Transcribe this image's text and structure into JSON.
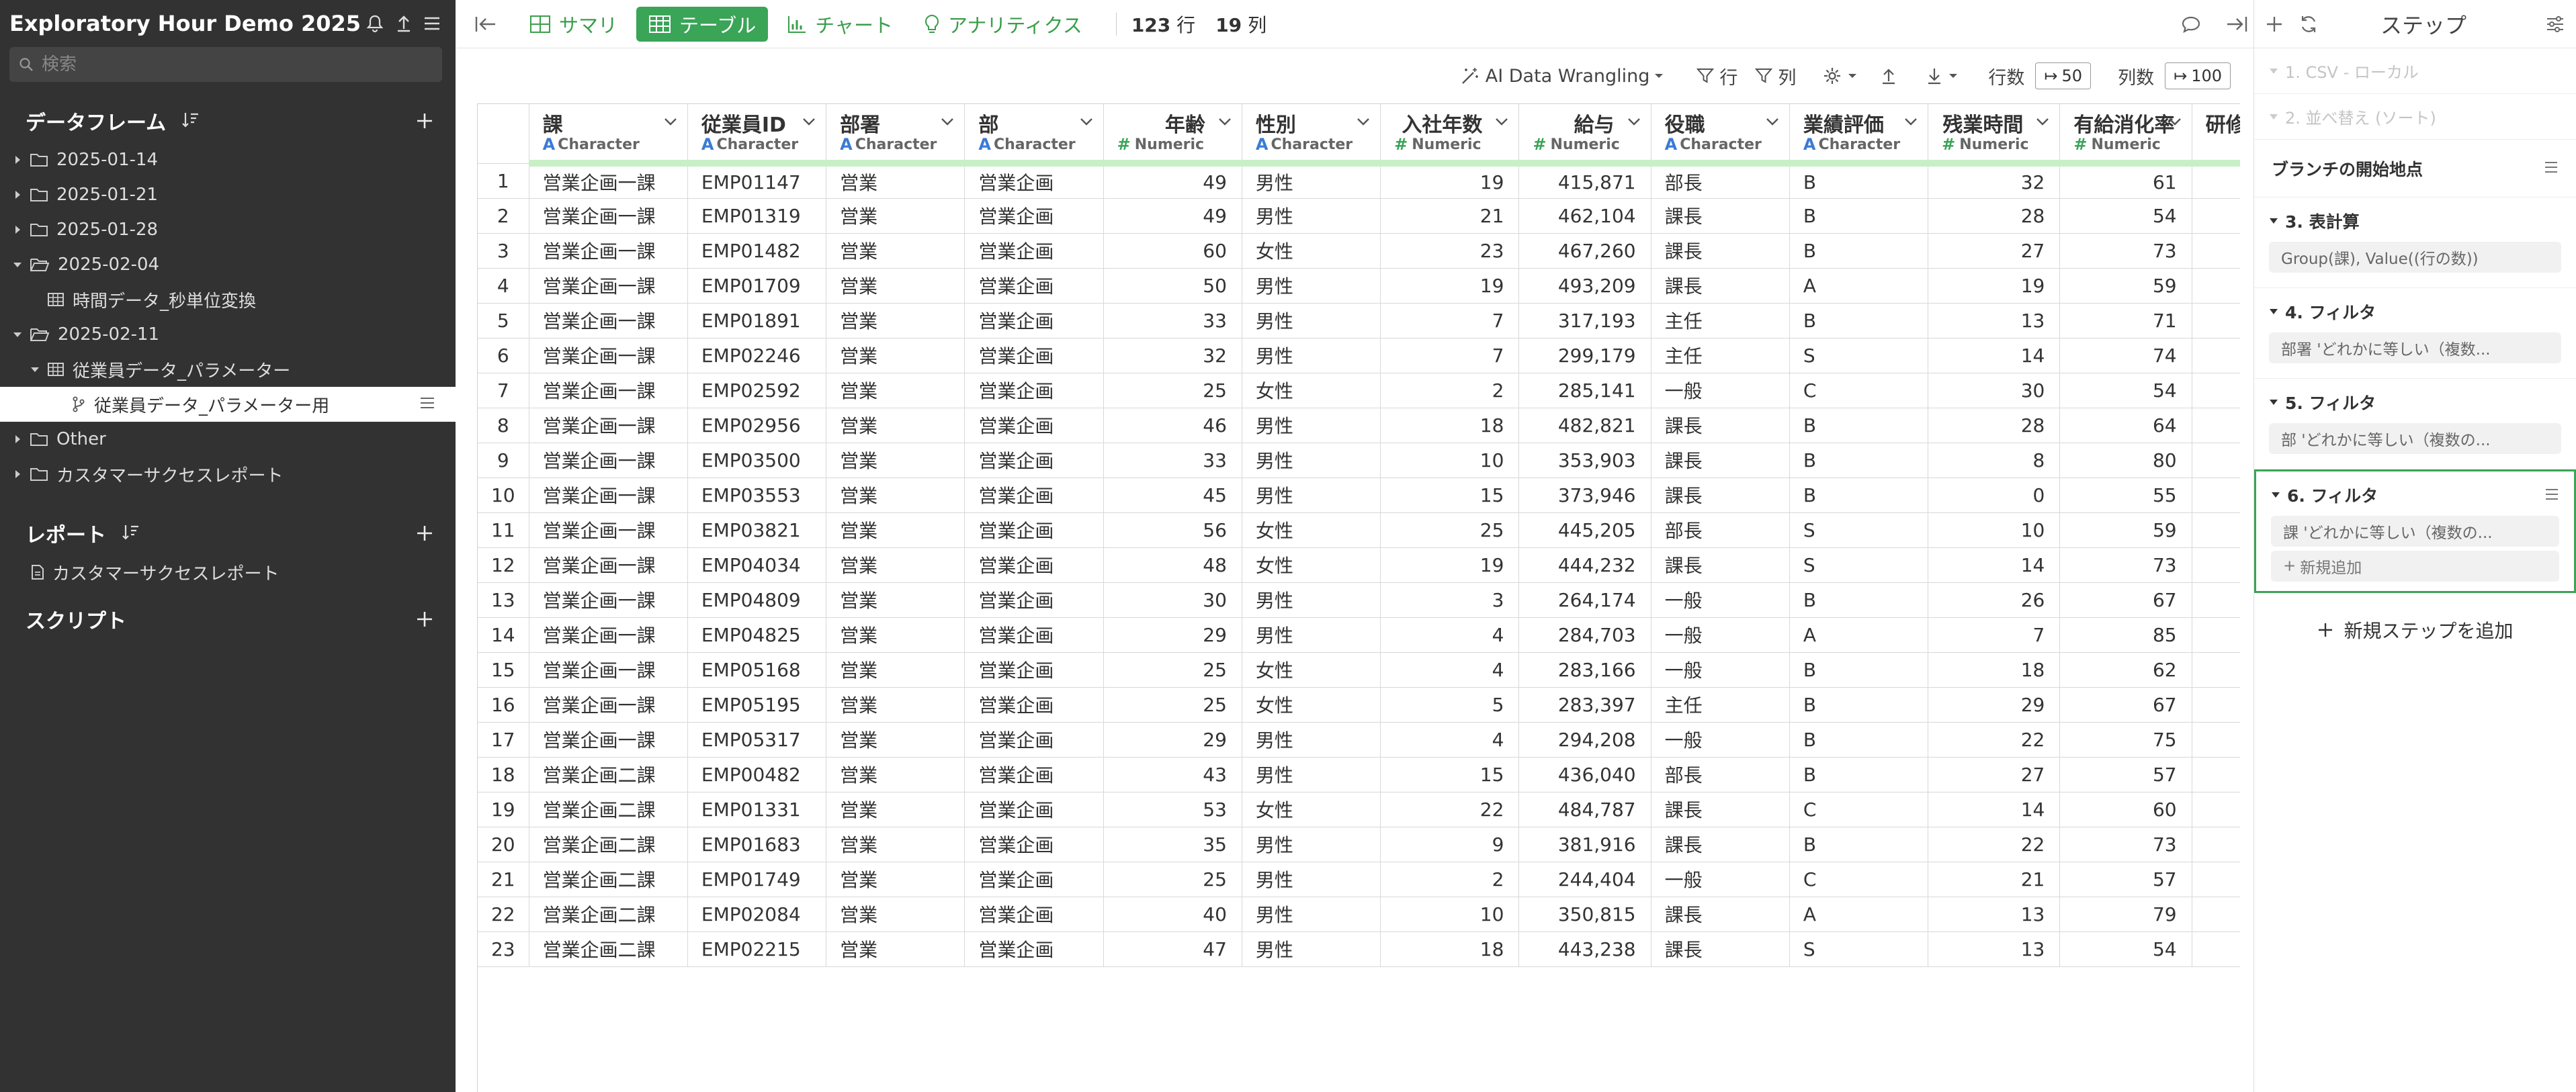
{
  "sidebar": {
    "title": "Exploratory Hour Demo 2025",
    "search_placeholder": "検索",
    "dataframes_title": "データフレーム",
    "tree": [
      {
        "label": "2025-01-14",
        "level": 0,
        "kind": "folder",
        "open": false
      },
      {
        "label": "2025-01-21",
        "level": 0,
        "kind": "folder",
        "open": false
      },
      {
        "label": "2025-01-28",
        "level": 0,
        "kind": "folder",
        "open": false
      },
      {
        "label": "2025-02-04",
        "level": 0,
        "kind": "folder",
        "open": true
      },
      {
        "label": "時間データ_秒単位変換",
        "level": 1,
        "kind": "table",
        "open": null
      },
      {
        "label": "2025-02-11",
        "level": 0,
        "kind": "folder",
        "open": true
      },
      {
        "label": "従業員データ_パラメーター",
        "level": 1,
        "kind": "table",
        "open": true
      },
      {
        "label": "従業員データ_パラメーター用",
        "level": 2,
        "kind": "branch",
        "open": null,
        "selected": true
      },
      {
        "label": "Other",
        "level": 0,
        "kind": "folder",
        "open": false
      },
      {
        "label": "カスタマーサクセスレポート",
        "level": 0,
        "kind": "folder",
        "open": false
      }
    ],
    "reports_title": "レポート",
    "reports": [
      "カスタマーサクセスレポート"
    ],
    "scripts_title": "スクリプト"
  },
  "toolbar": {
    "tabs": [
      {
        "label": "サマリ",
        "icon": "summary-icon",
        "active": false
      },
      {
        "label": "テーブル",
        "icon": "table-icon",
        "active": true
      },
      {
        "label": "チャート",
        "icon": "chart-icon",
        "active": false
      },
      {
        "label": "アナリティクス",
        "icon": "bulb-icon",
        "active": false
      }
    ],
    "rows_count": "123",
    "rows_label": "行",
    "cols_count": "19",
    "cols_label": "列"
  },
  "subbar": {
    "ai_label": "AI Data Wrangling",
    "row_filter_label": "行",
    "col_filter_label": "列",
    "rows_label": "行数",
    "rows_value": "50",
    "cols_label": "列数",
    "cols_value": "100"
  },
  "table": {
    "columns": [
      {
        "name": "課",
        "type": "Character",
        "numeric": false
      },
      {
        "name": "従業員ID",
        "type": "Character",
        "numeric": false
      },
      {
        "name": "部署",
        "type": "Character",
        "numeric": false
      },
      {
        "name": "部",
        "type": "Character",
        "numeric": false
      },
      {
        "name": "年齢",
        "type": "Numeric",
        "numeric": true
      },
      {
        "name": "性別",
        "type": "Character",
        "numeric": false
      },
      {
        "name": "入社年数",
        "type": "Numeric",
        "numeric": true
      },
      {
        "name": "給与",
        "type": "Numeric",
        "numeric": true
      },
      {
        "name": "役職",
        "type": "Character",
        "numeric": false
      },
      {
        "name": "業績評価",
        "type": "Character",
        "numeric": false
      },
      {
        "name": "残業時間",
        "type": "Numeric",
        "numeric": true
      },
      {
        "name": "有給消化率",
        "type": "Numeric",
        "numeric": true
      },
      {
        "name": "研修",
        "type": "",
        "numeric": false
      }
    ],
    "rows": [
      [
        "1",
        "営業企画一課",
        "EMP01147",
        "営業",
        "営業企画",
        "49",
        "男性",
        "19",
        "415,871",
        "部長",
        "B",
        "32",
        "61",
        ""
      ],
      [
        "2",
        "営業企画一課",
        "EMP01319",
        "営業",
        "営業企画",
        "49",
        "男性",
        "21",
        "462,104",
        "課長",
        "B",
        "28",
        "54",
        ""
      ],
      [
        "3",
        "営業企画一課",
        "EMP01482",
        "営業",
        "営業企画",
        "60",
        "女性",
        "23",
        "467,260",
        "課長",
        "B",
        "27",
        "73",
        ""
      ],
      [
        "4",
        "営業企画一課",
        "EMP01709",
        "営業",
        "営業企画",
        "50",
        "男性",
        "19",
        "493,209",
        "課長",
        "A",
        "19",
        "59",
        ""
      ],
      [
        "5",
        "営業企画一課",
        "EMP01891",
        "営業",
        "営業企画",
        "33",
        "男性",
        "7",
        "317,193",
        "主任",
        "B",
        "13",
        "71",
        ""
      ],
      [
        "6",
        "営業企画一課",
        "EMP02246",
        "営業",
        "営業企画",
        "32",
        "男性",
        "7",
        "299,179",
        "主任",
        "S",
        "14",
        "74",
        ""
      ],
      [
        "7",
        "営業企画一課",
        "EMP02592",
        "営業",
        "営業企画",
        "25",
        "女性",
        "2",
        "285,141",
        "一般",
        "C",
        "30",
        "54",
        ""
      ],
      [
        "8",
        "営業企画一課",
        "EMP02956",
        "営業",
        "営業企画",
        "46",
        "男性",
        "18",
        "482,821",
        "課長",
        "B",
        "28",
        "64",
        ""
      ],
      [
        "9",
        "営業企画一課",
        "EMP03500",
        "営業",
        "営業企画",
        "33",
        "男性",
        "10",
        "353,903",
        "課長",
        "B",
        "8",
        "80",
        ""
      ],
      [
        "10",
        "営業企画一課",
        "EMP03553",
        "営業",
        "営業企画",
        "45",
        "男性",
        "15",
        "373,946",
        "課長",
        "B",
        "0",
        "55",
        ""
      ],
      [
        "11",
        "営業企画一課",
        "EMP03821",
        "営業",
        "営業企画",
        "56",
        "女性",
        "25",
        "445,205",
        "部長",
        "S",
        "10",
        "59",
        ""
      ],
      [
        "12",
        "営業企画一課",
        "EMP04034",
        "営業",
        "営業企画",
        "48",
        "女性",
        "19",
        "444,232",
        "課長",
        "S",
        "14",
        "73",
        ""
      ],
      [
        "13",
        "営業企画一課",
        "EMP04809",
        "営業",
        "営業企画",
        "30",
        "男性",
        "3",
        "264,174",
        "一般",
        "B",
        "26",
        "67",
        ""
      ],
      [
        "14",
        "営業企画一課",
        "EMP04825",
        "営業",
        "営業企画",
        "29",
        "男性",
        "4",
        "284,703",
        "一般",
        "A",
        "7",
        "85",
        ""
      ],
      [
        "15",
        "営業企画一課",
        "EMP05168",
        "営業",
        "営業企画",
        "25",
        "女性",
        "4",
        "283,166",
        "一般",
        "B",
        "18",
        "62",
        ""
      ],
      [
        "16",
        "営業企画一課",
        "EMP05195",
        "営業",
        "営業企画",
        "25",
        "女性",
        "5",
        "283,397",
        "主任",
        "B",
        "29",
        "67",
        ""
      ],
      [
        "17",
        "営業企画一課",
        "EMP05317",
        "営業",
        "営業企画",
        "29",
        "男性",
        "4",
        "294,208",
        "一般",
        "B",
        "22",
        "75",
        ""
      ],
      [
        "18",
        "営業企画二課",
        "EMP00482",
        "営業",
        "営業企画",
        "43",
        "男性",
        "15",
        "436,040",
        "部長",
        "B",
        "27",
        "57",
        ""
      ],
      [
        "19",
        "営業企画二課",
        "EMP01331",
        "営業",
        "営業企画",
        "53",
        "女性",
        "22",
        "484,787",
        "課長",
        "C",
        "14",
        "60",
        ""
      ],
      [
        "20",
        "営業企画二課",
        "EMP01683",
        "営業",
        "営業企画",
        "35",
        "男性",
        "9",
        "381,916",
        "課長",
        "B",
        "22",
        "73",
        ""
      ],
      [
        "21",
        "営業企画二課",
        "EMP01749",
        "営業",
        "営業企画",
        "25",
        "男性",
        "2",
        "244,404",
        "一般",
        "C",
        "21",
        "57",
        ""
      ],
      [
        "22",
        "営業企画二課",
        "EMP02084",
        "営業",
        "営業企画",
        "40",
        "男性",
        "10",
        "350,815",
        "課長",
        "A",
        "13",
        "79",
        ""
      ],
      [
        "23",
        "営業企画二課",
        "EMP02215",
        "営業",
        "営業企画",
        "47",
        "男性",
        "18",
        "443,238",
        "課長",
        "S",
        "13",
        "54",
        ""
      ]
    ]
  },
  "steps": {
    "title": "ステップ",
    "disabled": [
      "1. CSV - ローカル",
      "2. 並べ替え (ソート)"
    ],
    "branch_label": "ブランチの開始地点",
    "items": [
      {
        "title": "3. 表計算",
        "chip": "Group(課), Value((行の数))",
        "active": false
      },
      {
        "title": "4. フィルタ",
        "chip": "部署 'どれかに等しい（複数...",
        "active": false
      },
      {
        "title": "5. フィルタ",
        "chip": "部 'どれかに等しい（複数の...",
        "active": false
      },
      {
        "title": "6. フィルタ",
        "chip": "課 'どれかに等しい（複数の...",
        "active": true,
        "add_label": "新規追加"
      }
    ],
    "add_step_label": "新規ステップを追加"
  },
  "colors": {
    "accent": "#3aa457",
    "sidebar_bg": "#323232",
    "character": "#3a7bd5"
  }
}
